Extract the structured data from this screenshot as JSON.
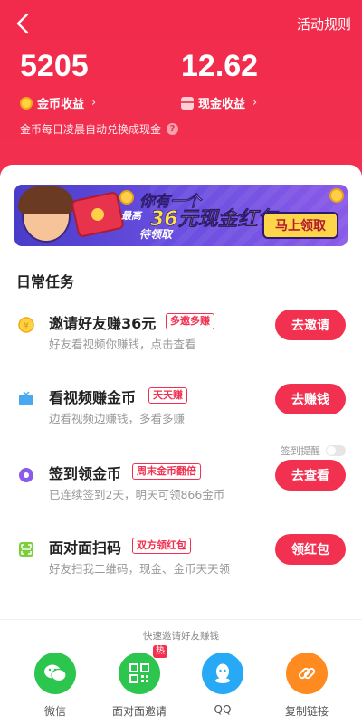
{
  "header": {
    "back_icon": "back-arrow-icon",
    "rules_label": "活动规则",
    "coins": {
      "value": "5205",
      "label": "金币收益",
      "chevron": "›"
    },
    "cash": {
      "value": "12.62",
      "label": "现金收益",
      "chevron": "›"
    },
    "auto_note": "金币每日凌晨自动兑换成现金",
    "help_glyph": "?"
  },
  "banner": {
    "line1": "你有一个",
    "line2": "最高",
    "big": "36元现金红包",
    "line3": "待领取",
    "button": "马上领取"
  },
  "daily": {
    "title": "日常任务",
    "tasks": [
      {
        "title": "邀请好友赚36元",
        "tag": "多邀多赚",
        "desc": "好友看视频你赚钱，点击查看",
        "button": "去邀请",
        "icon": "gold-coin-icon"
      },
      {
        "title": "看视频赚金币",
        "tag": "天天赚",
        "desc": "边看视频边赚钱，多看多赚",
        "button": "去赚钱",
        "icon": "tv-icon"
      },
      {
        "title": "签到领金币",
        "tag": "周末金币翻倍",
        "desc": "已连续签到2天，明天可领866金币",
        "button": "去查看",
        "icon": "location-pin-icon"
      },
      {
        "title": "面对面扫码",
        "tag": "双方领红包",
        "desc": "好友扫我二维码，现金、金币天天领",
        "button": "领红包",
        "icon": "scan-icon"
      }
    ],
    "remind_label": "签到提醒"
  },
  "share": {
    "title": "快速邀请好友赚钱",
    "hot_badge": "热",
    "items": [
      {
        "label": "微信",
        "icon": "wechat-icon",
        "color": "#2cc54d"
      },
      {
        "label": "面对面邀请",
        "icon": "qrcode-icon",
        "color": "#2cc54d"
      },
      {
        "label": "QQ",
        "icon": "qq-icon",
        "color": "#28a9f5"
      },
      {
        "label": "复制链接",
        "icon": "link-icon",
        "color": "#ff8a1f"
      }
    ]
  },
  "colors": {
    "primary": "#f2304f",
    "accent_yellow": "#ffd54a"
  }
}
